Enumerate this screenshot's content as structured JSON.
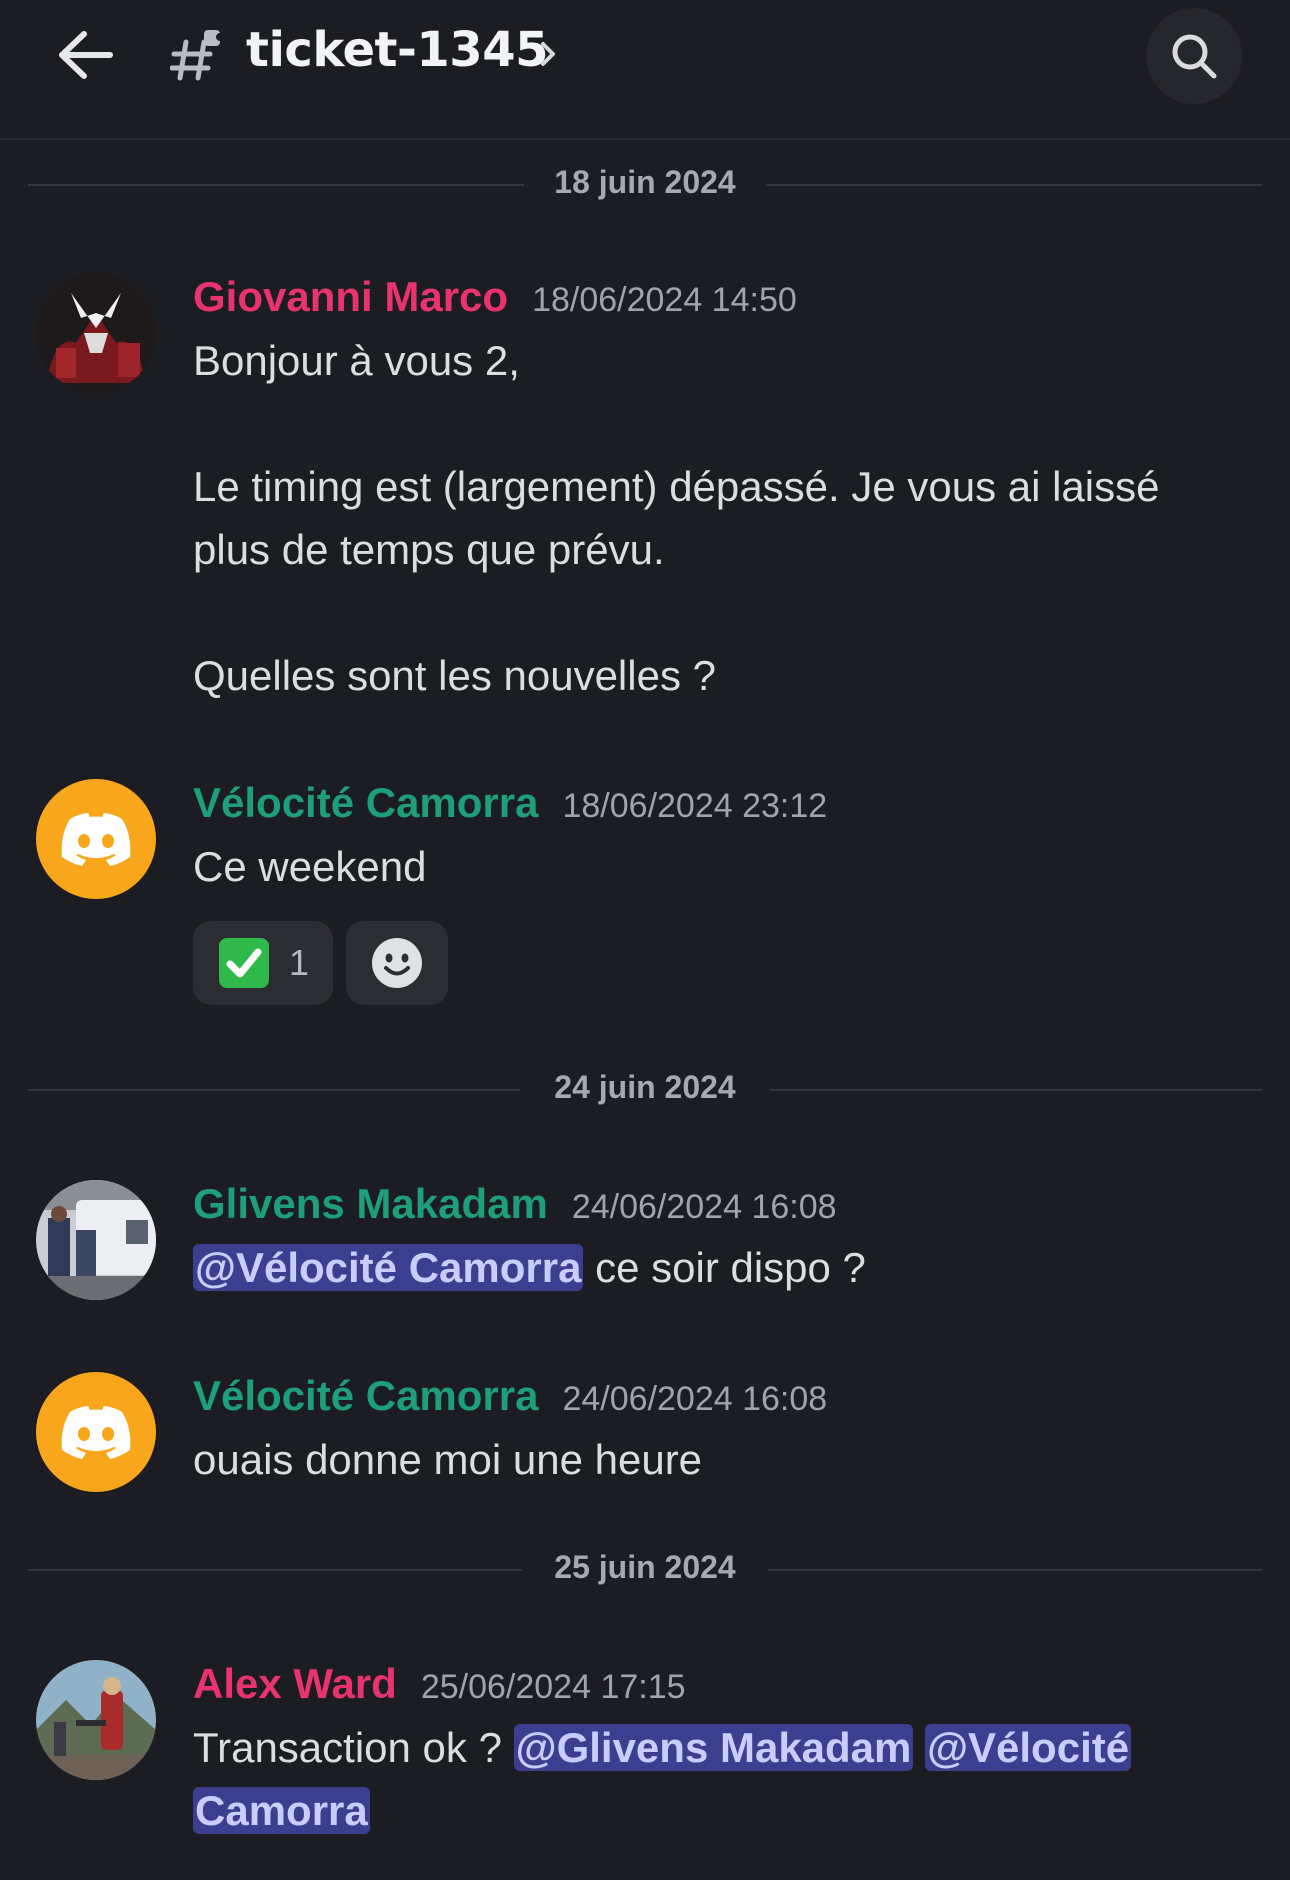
{
  "header": {
    "channel_name": "ticket-1345"
  },
  "date_dividers": [
    "18 juin 2024",
    "24 juin 2024",
    "25 juin 2024"
  ],
  "messages": [
    {
      "author": "Giovanni Marco",
      "timestamp": "18/06/2024 14:50",
      "lines": [
        "Bonjour à vous 2,",
        "",
        "Le timing est (largement) dépassé. Je vous ai laissé",
        "plus de temps que prévu.",
        "",
        "Quelles sont les nouvelles ?"
      ]
    },
    {
      "author": "Vélocité Camorra",
      "timestamp": "18/06/2024 23:12",
      "text": "Ce weekend",
      "reaction": {
        "emoji": "✅",
        "count": "1"
      }
    },
    {
      "author": "Glivens Makadam",
      "timestamp": "24/06/2024 16:08",
      "mention": "@Vélocité Camorra",
      "text": " ce soir dispo ?"
    },
    {
      "author": "Vélocité Camorra",
      "timestamp": "24/06/2024 16:08",
      "text": "ouais donne moi une heure"
    },
    {
      "author": "Alex Ward",
      "timestamp": "25/06/2024 17:15",
      "text": "Transaction ok ? ",
      "mention_1": "@Glivens Makadam",
      "mention_2_part1": "@Vélocité",
      "mention_2_part2": "Camorra"
    }
  ],
  "colors": {
    "background": "#1c1d22",
    "author_pink": "#e8336e",
    "author_green": "#1f9e7a",
    "mention_bg": "#3c3f8f",
    "discord_avatar": "#f8a61c"
  },
  "icons": [
    "back-arrow-icon",
    "channel-thread-icon",
    "chevron-right-icon",
    "search-icon",
    "discord-logo-icon",
    "add-reaction-icon"
  ]
}
